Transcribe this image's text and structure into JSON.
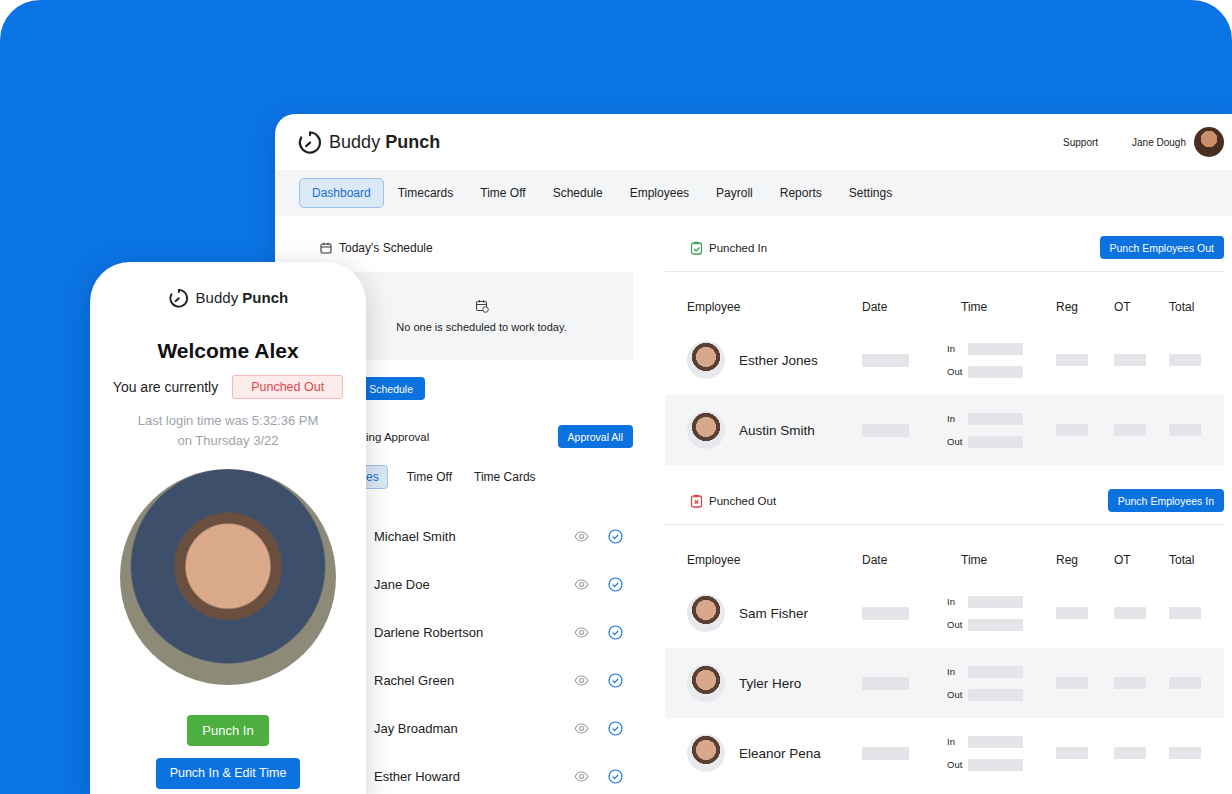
{
  "brand": {
    "light": "Buddy",
    "bold": "Punch"
  },
  "header": {
    "support": "Support",
    "user": "Jane Dough"
  },
  "nav": [
    {
      "label": "Dashboard",
      "selected": true
    },
    {
      "label": "Timecards",
      "selected": false
    },
    {
      "label": "Time Off",
      "selected": false
    },
    {
      "label": "Schedule",
      "selected": false
    },
    {
      "label": "Employees",
      "selected": false
    },
    {
      "label": "Payroll",
      "selected": false
    },
    {
      "label": "Reports",
      "selected": false
    },
    {
      "label": "Settings",
      "selected": false
    }
  ],
  "schedule": {
    "title": "Today's Schedule",
    "empty": "No one is scheduled to work today.",
    "button": "Schedule"
  },
  "approval": {
    "title": "ing Approval",
    "button": "Approval All",
    "tabs": [
      {
        "label": "es",
        "selected": true
      },
      {
        "label": "Time Off",
        "selected": false
      },
      {
        "label": "Time Cards",
        "selected": false
      }
    ],
    "items": [
      "Michael Smith",
      "Jane Doe",
      "Darlene Robertson",
      "Rachel Green",
      "Jay Broadman",
      "Esther Howard"
    ]
  },
  "sections": [
    {
      "kind": "in",
      "title": "Punched In",
      "button": "Punch Employees Out",
      "columns": [
        "Employee",
        "Date",
        "Time",
        "Reg",
        "OT",
        "Total"
      ],
      "time_labels": [
        "In",
        "Out"
      ],
      "rows": [
        "Esther Jones",
        "Austin Smith"
      ]
    },
    {
      "kind": "out",
      "title": "Punched Out",
      "button": "Punch Employees In",
      "columns": [
        "Employee",
        "Date",
        "Time",
        "Reg",
        "OT",
        "Total"
      ],
      "time_labels": [
        "In",
        "Out"
      ],
      "rows": [
        "Sam Fisher",
        "Tyler Hero",
        "Eleanor Pena"
      ]
    }
  ],
  "phone": {
    "welcome": "Welcome Alex",
    "status_label": "You are currently",
    "status": "Punched Out",
    "last_login": "Last login time was 5:32:36 PM",
    "last_login_date": "on Thursday 3/22",
    "buttons": [
      "Punch In",
      "Punch In & Edit Time"
    ]
  }
}
